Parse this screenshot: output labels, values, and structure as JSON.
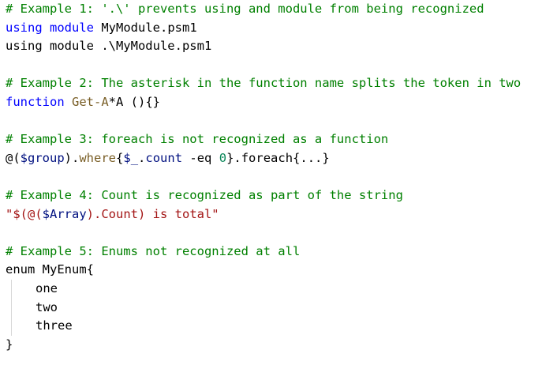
{
  "colors": {
    "comment": "#008000",
    "keyword": "#0000ff",
    "function": "#795e26",
    "variable": "#001080",
    "string": "#a31515",
    "operator": "#000000",
    "number": "#098658",
    "plain": "#000000"
  },
  "lines": [
    {
      "tokens": [
        {
          "t": "comment",
          "text": "# Example 1: '.\\' prevents using and module from being recognized"
        }
      ]
    },
    {
      "tokens": [
        {
          "t": "keyword",
          "text": "using"
        },
        {
          "t": "plain",
          "text": " "
        },
        {
          "t": "keyword",
          "text": "module"
        },
        {
          "t": "plain",
          "text": " MyModule.psm1"
        }
      ]
    },
    {
      "tokens": [
        {
          "t": "plain",
          "text": "using module .\\MyModule.psm1"
        }
      ]
    },
    {
      "tokens": []
    },
    {
      "tokens": [
        {
          "t": "comment",
          "text": "# Example 2: The asterisk in the function name splits the token in two"
        }
      ]
    },
    {
      "tokens": [
        {
          "t": "keyword",
          "text": "function"
        },
        {
          "t": "plain",
          "text": " "
        },
        {
          "t": "function",
          "text": "Get-A"
        },
        {
          "t": "plain",
          "text": "*A (){}"
        }
      ]
    },
    {
      "tokens": []
    },
    {
      "tokens": [
        {
          "t": "comment",
          "text": "# Example 3: foreach is not recognized as a function"
        }
      ]
    },
    {
      "tokens": [
        {
          "t": "plain",
          "text": "@("
        },
        {
          "t": "variable",
          "text": "$group"
        },
        {
          "t": "plain",
          "text": ")."
        },
        {
          "t": "function",
          "text": "where"
        },
        {
          "t": "plain",
          "text": "{"
        },
        {
          "t": "variable",
          "text": "$_"
        },
        {
          "t": "plain",
          "text": "."
        },
        {
          "t": "variable",
          "text": "count"
        },
        {
          "t": "plain",
          "text": " -eq "
        },
        {
          "t": "number",
          "text": "0"
        },
        {
          "t": "plain",
          "text": "}.foreach{...}"
        }
      ]
    },
    {
      "tokens": []
    },
    {
      "tokens": [
        {
          "t": "comment",
          "text": "# Example 4: Count is recognized as part of the string"
        }
      ]
    },
    {
      "tokens": [
        {
          "t": "string",
          "text": "\"$(@("
        },
        {
          "t": "variable",
          "text": "$Array"
        },
        {
          "t": "string",
          "text": ").Count) is total\""
        }
      ]
    },
    {
      "tokens": []
    },
    {
      "tokens": [
        {
          "t": "comment",
          "text": "# Example 5: Enums not recognized at all"
        }
      ]
    },
    {
      "tokens": [
        {
          "t": "plain",
          "text": "enum MyEnum{"
        }
      ]
    },
    {
      "indent": true,
      "tokens": [
        {
          "t": "plain",
          "text": "one"
        }
      ]
    },
    {
      "indent": true,
      "tokens": [
        {
          "t": "plain",
          "text": "two"
        }
      ]
    },
    {
      "indent": true,
      "tokens": [
        {
          "t": "plain",
          "text": "three"
        }
      ]
    },
    {
      "tokens": [
        {
          "t": "plain",
          "text": "}"
        }
      ]
    }
  ]
}
